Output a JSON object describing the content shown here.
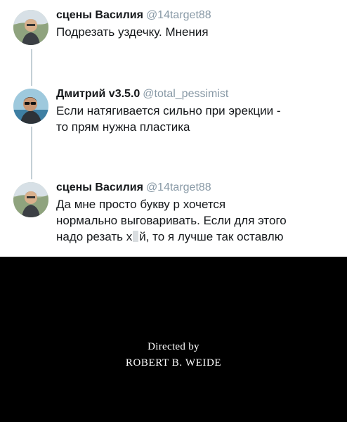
{
  "tweets": [
    {
      "name": "сцены Василия",
      "handle": "@14target88",
      "avatar": "avatar-young-man-outdoors",
      "lines": [
        "Подрезать уздечку. Мнения"
      ]
    },
    {
      "name": "Дмитрий v3.5.0",
      "handle": "@total_pessimist",
      "avatar": "avatar-man-sunglasses-sea",
      "lines": [
        "Если натягивается сильно при эрекции -",
        "то прям нужна пластика"
      ]
    },
    {
      "name": "сцены Василия",
      "handle": "@14target88",
      "avatar": "avatar-young-man-outdoors",
      "lines": [
        "Да мне просто букву р хочется",
        "нормально выговаривать. Если для этого"
      ],
      "last_line_before": "надо резать х",
      "last_line_after": "й, то я лучше так оставлю"
    }
  ],
  "credits": {
    "line1": "Directed by",
    "line2": "ROBERT B. WEIDE"
  },
  "colors": {
    "name": "#14171a",
    "handle": "#8899a6",
    "thread_line": "#c4cfd6",
    "credits_bg": "#000000",
    "credits_text": "#ffffff"
  }
}
